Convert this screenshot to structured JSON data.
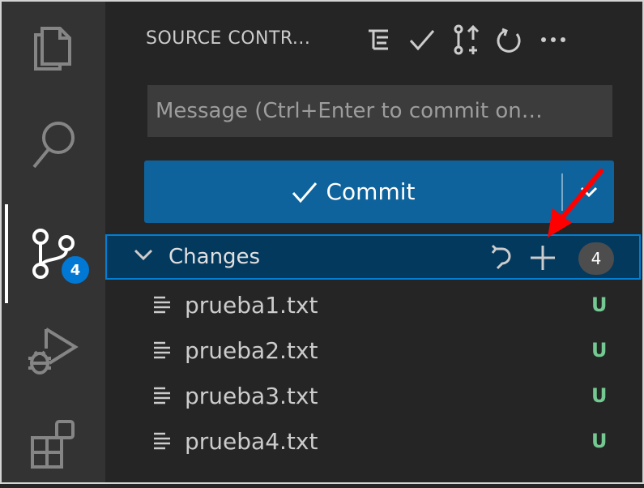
{
  "activity_bar": {
    "items": [
      {
        "name": "explorer",
        "icon": "files-icon"
      },
      {
        "name": "search",
        "icon": "search-icon"
      },
      {
        "name": "source-control",
        "icon": "source-control-icon",
        "badge": "4",
        "active": true
      },
      {
        "name": "run-and-debug",
        "icon": "run-debug-icon"
      },
      {
        "name": "extensions",
        "icon": "extensions-icon"
      }
    ]
  },
  "sidebar": {
    "title": "SOURCE CONTR...",
    "actions": [
      "view-as-tree-icon",
      "commit-check-icon",
      "pull-request-icon",
      "refresh-icon",
      "more-actions-icon"
    ]
  },
  "commit": {
    "message_placeholder": "Message (Ctrl+Enter to commit on…",
    "message_value": "",
    "button_label": "Commit"
  },
  "changes": {
    "label": "Changes",
    "count": "4",
    "files": [
      {
        "name": "prueba1.txt",
        "status": "U"
      },
      {
        "name": "prueba2.txt",
        "status": "U"
      },
      {
        "name": "prueba3.txt",
        "status": "U"
      },
      {
        "name": "prueba4.txt",
        "status": "U"
      }
    ]
  },
  "colors": {
    "activity_bar": "#333333",
    "sidebar": "#252526",
    "commit_button": "#0e639c",
    "selection": "#04395e",
    "focus_border": "#007fd4",
    "untracked": "#73c991",
    "badge": "#0078d4",
    "annotation_arrow": "#ff0000"
  }
}
